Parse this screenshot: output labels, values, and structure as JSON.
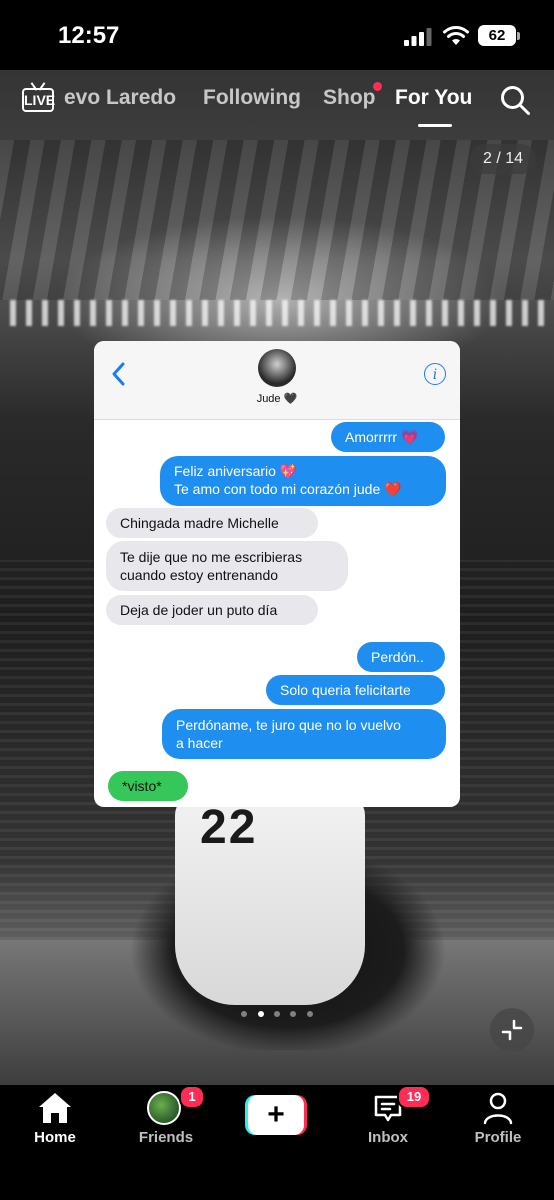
{
  "status_bar": {
    "time": "12:57",
    "battery": "62"
  },
  "top_nav": {
    "live_label": "LIVE",
    "tabs": [
      {
        "label": "evo Laredo"
      },
      {
        "label": "Following"
      },
      {
        "label": "Shop"
      },
      {
        "label": "For You"
      }
    ]
  },
  "slide_counter": "2 / 14",
  "message_card": {
    "contact_name": "Jude 🖤",
    "messages": [
      {
        "side": "outgoing",
        "lines": [
          "Amorrrrr 💗"
        ]
      },
      {
        "side": "outgoing",
        "lines": [
          "Feliz aniversario 💖",
          "Te amo con todo mi corazón jude ❤️"
        ]
      },
      {
        "side": "incoming",
        "lines": [
          "Chingada madre Michelle"
        ]
      },
      {
        "side": "incoming",
        "lines": [
          "Te dije que no me escribieras",
          "cuando estoy entrenando"
        ]
      },
      {
        "side": "incoming",
        "lines": [
          "Deja de joder un puto día"
        ]
      },
      {
        "side": "outgoing",
        "lines": [
          "Perdón.."
        ]
      },
      {
        "side": "outgoing",
        "lines": [
          "Solo queria felicitarte"
        ]
      },
      {
        "side": "outgoing",
        "lines": [
          "Perdóname, te juro que no lo vuelvo",
          "a hacer"
        ]
      },
      {
        "side": "green",
        "lines": [
          "*visto*"
        ]
      }
    ]
  },
  "background": {
    "shirt_number": "22"
  },
  "bottom_nav": {
    "home": "Home",
    "friends": "Friends",
    "friends_badge": "1",
    "create": "+",
    "inbox": "Inbox",
    "inbox_badge": "19",
    "profile": "Profile"
  },
  "colors": {
    "outgoing_bubble": "#1f8ef1",
    "incoming_bubble": "#e7e7ec",
    "visto_bubble": "#35c759",
    "badge": "#ff2d55"
  }
}
